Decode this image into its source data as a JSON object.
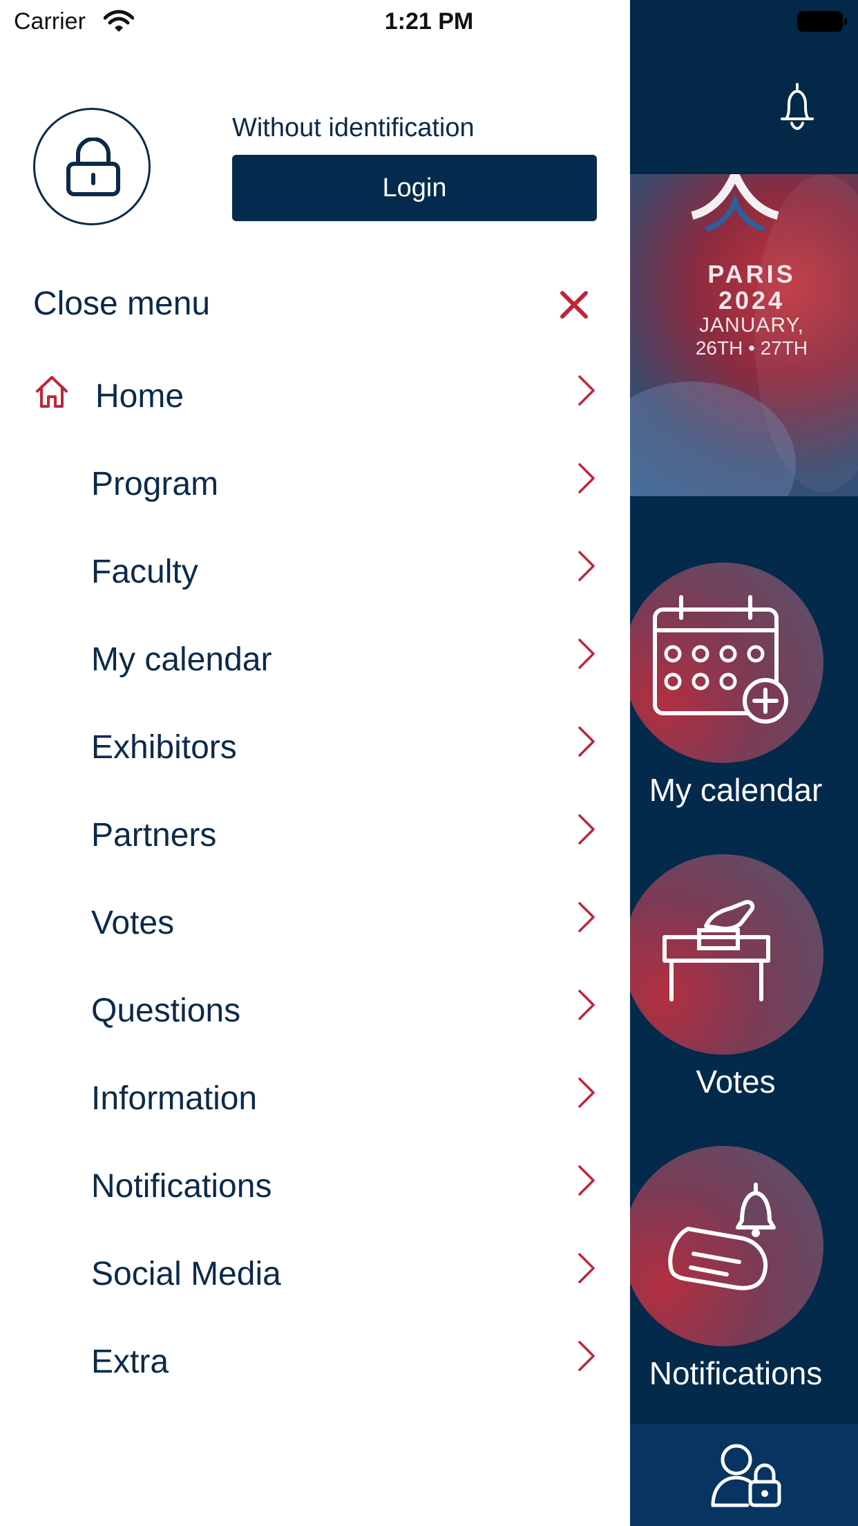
{
  "status_bar": {
    "carrier": "Carrier",
    "time": "1:21 PM"
  },
  "drawer": {
    "auth_status": "Without identification",
    "login_label": "Login",
    "close_label": "Close menu",
    "items": [
      {
        "label": "Home",
        "icon": "home-icon"
      },
      {
        "label": "Program"
      },
      {
        "label": "Faculty"
      },
      {
        "label": "My calendar"
      },
      {
        "label": "Exhibitors"
      },
      {
        "label": "Partners"
      },
      {
        "label": "Votes"
      },
      {
        "label": "Questions"
      },
      {
        "label": "Information"
      },
      {
        "label": "Notifications"
      },
      {
        "label": "Social Media"
      },
      {
        "label": "Extra"
      }
    ]
  },
  "background": {
    "banner": {
      "city": "PARIS",
      "year": "2024",
      "date": "JANUARY,",
      "days": "26TH • 27TH"
    },
    "tiles": [
      {
        "label": "My calendar",
        "icon": "calendar-add-icon"
      },
      {
        "label": "Votes",
        "icon": "ballot-box-icon"
      },
      {
        "label": "Notifications",
        "icon": "notification-icon"
      }
    ]
  },
  "colors": {
    "navy": "#0b2a4a",
    "button": "#042b4d",
    "accent_red": "#c0253a",
    "background_navy": "#03294b"
  }
}
